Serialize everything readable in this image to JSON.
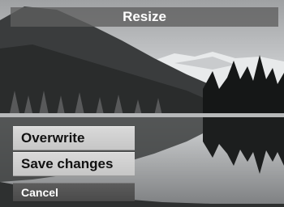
{
  "title": "Resize",
  "menu": {
    "overwrite_label": "Overwrite",
    "save_changes_label": "Save changes",
    "cancel_label": "Cancel"
  },
  "colors": {
    "title_bar_bg": "#5f5f5f",
    "menu_item_bg": "#d0d0d0",
    "cancel_bg": "#505050"
  }
}
